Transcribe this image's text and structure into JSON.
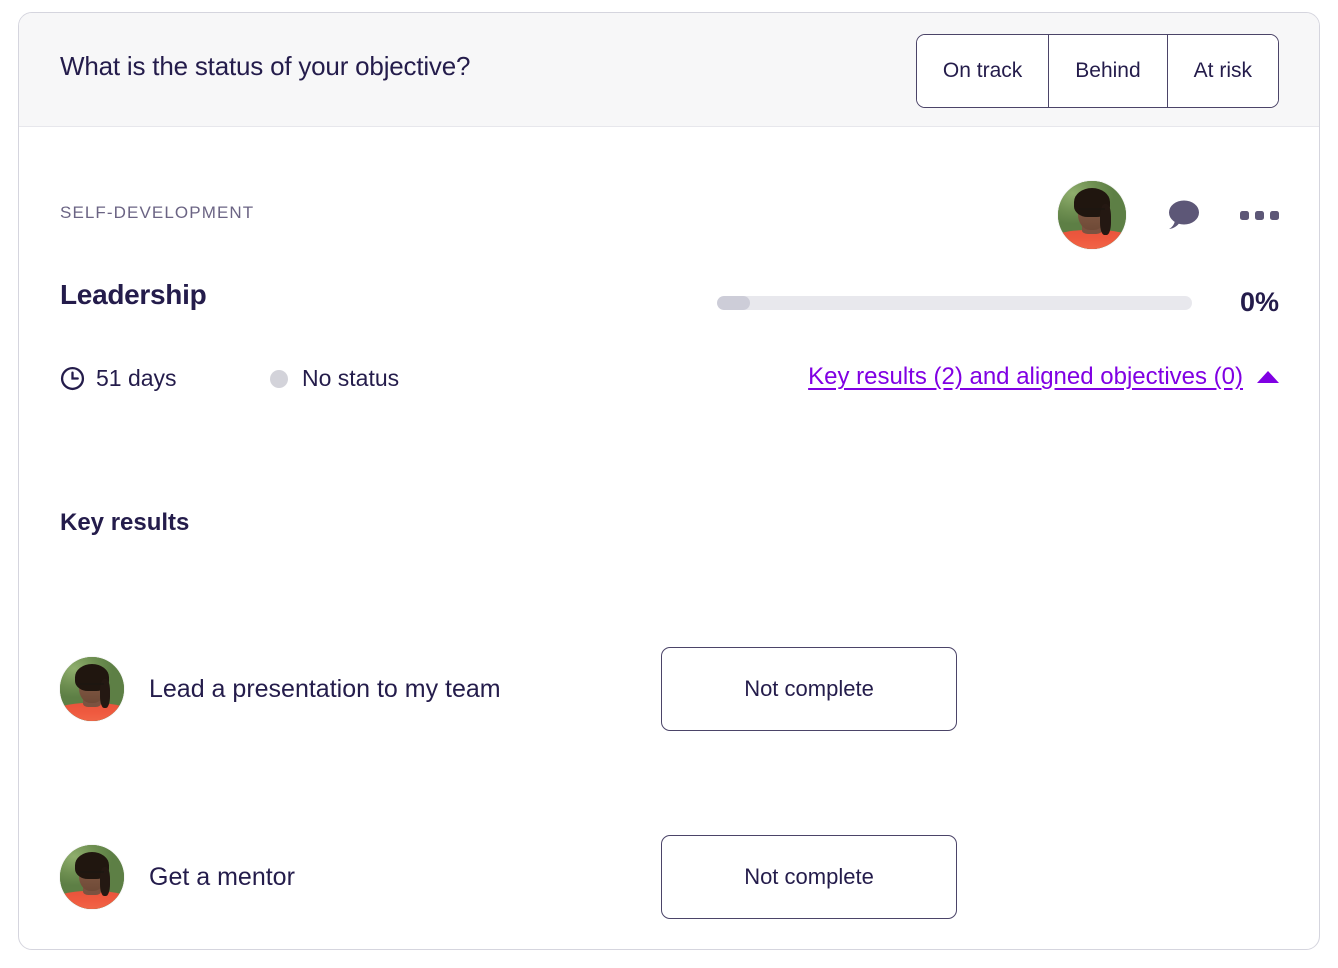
{
  "header": {
    "question": "What is the status of your objective?",
    "status_options": [
      {
        "label": "On track",
        "name": "on-track"
      },
      {
        "label": "Behind",
        "name": "behind"
      },
      {
        "label": "At risk",
        "name": "at-risk"
      }
    ]
  },
  "objective": {
    "category": "Self-development",
    "title": "Leadership",
    "progress_percent": "0%",
    "progress_fill_ratio": 7,
    "due": "51 days",
    "status": "No status",
    "expand_link": "Key results (2) and aligned objectives (0)",
    "expanded": true,
    "icons": {
      "clock": "clock-icon",
      "comment": "comment-bubble-icon",
      "more": "more-options-icon",
      "caret": "caret-up-icon",
      "owner_avatar": "owner-avatar"
    }
  },
  "key_results": {
    "heading": "Key results",
    "items": [
      {
        "title": "Lead a presentation to my team",
        "status": "Not complete"
      },
      {
        "title": "Get a mentor",
        "status": "Not complete"
      }
    ]
  },
  "colors": {
    "accent_link": "#8000e3",
    "text_primary": "#241c4b",
    "text_muted": "#6b6484",
    "header_bg": "#f7f7f8",
    "progress_track": "#e8e8ed",
    "progress_fill": "#cdcdd8",
    "icon_muted": "#5d5777"
  }
}
